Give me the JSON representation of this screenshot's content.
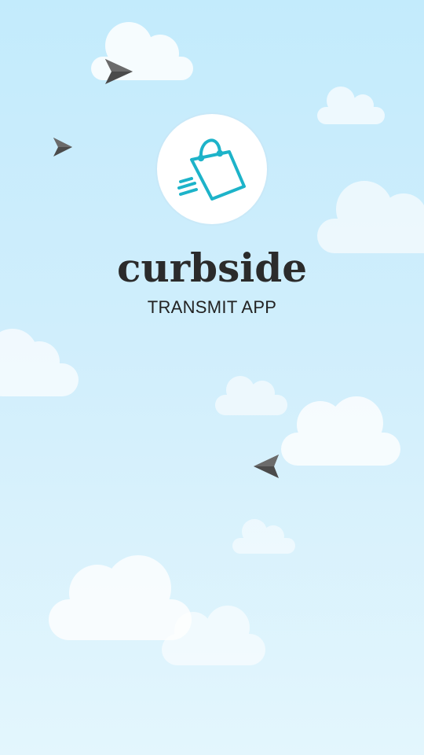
{
  "app": {
    "name": "curbside",
    "subtitle": "TRANSMIT APP"
  },
  "logo": {
    "icon": "shopping-bag-icon",
    "accent_color": "#1db3c9"
  },
  "background": {
    "sky_top": "#c3ebfc",
    "sky_bottom": "#e3f6fd",
    "cloud_color": "#ffffff",
    "plane_color": "#4d4d4d"
  }
}
